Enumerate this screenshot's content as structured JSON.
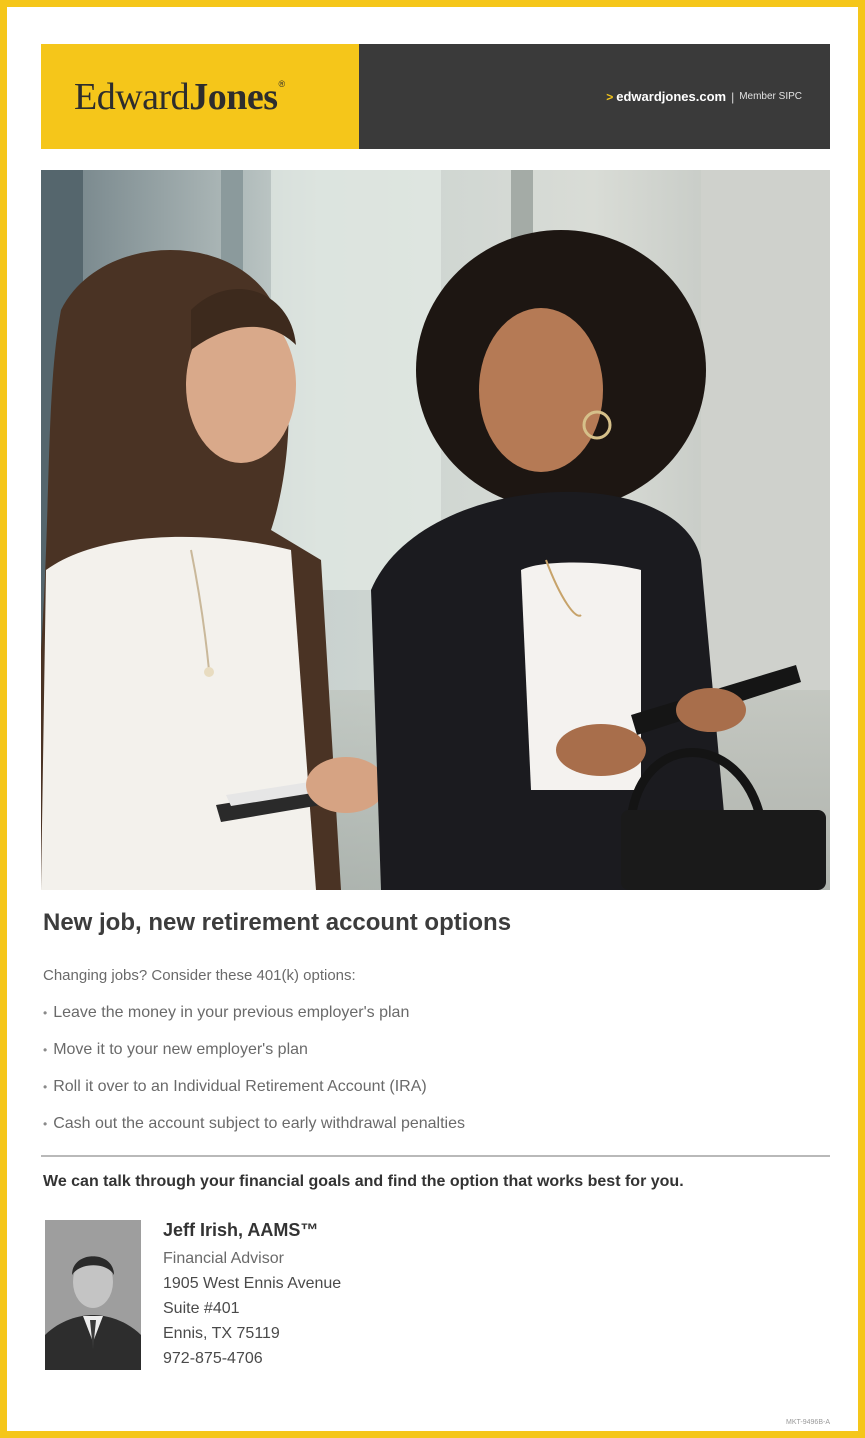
{
  "header": {
    "logo_word1": "Edward",
    "logo_word2": "Jones",
    "logo_mark": "®",
    "arrow": ">",
    "url": "edwardjones.com",
    "separator": "|",
    "member": "Member SIPC"
  },
  "photo": {
    "alt": "Two women in business attire walking and talking, one holding a tablet and folder"
  },
  "content": {
    "headline": "New job, new retirement account options",
    "intro": "Changing jobs? Consider these 401(k) options:",
    "options": [
      "Leave the money in your previous employer's plan",
      "Move it to your new employer's plan",
      "Roll it over to an Individual Retirement Account (IRA)",
      "Cash out the account subject to early withdrawal penalties"
    ],
    "bullet": "•",
    "tagline": "We can talk through your financial goals and find the option that works best for you."
  },
  "advisor": {
    "name": "Jeff Irish, AAMS™",
    "title": "Financial Advisor",
    "address1": "1905 West Ennis Avenue",
    "address2": "Suite #401",
    "city": "Ennis, TX 75119",
    "phone": "972-875-4706"
  },
  "colors": {
    "brand_yellow": "#f5c61a",
    "header_dark": "#3a3a3a"
  },
  "footer": {
    "code": "MKT-9496B-A"
  }
}
